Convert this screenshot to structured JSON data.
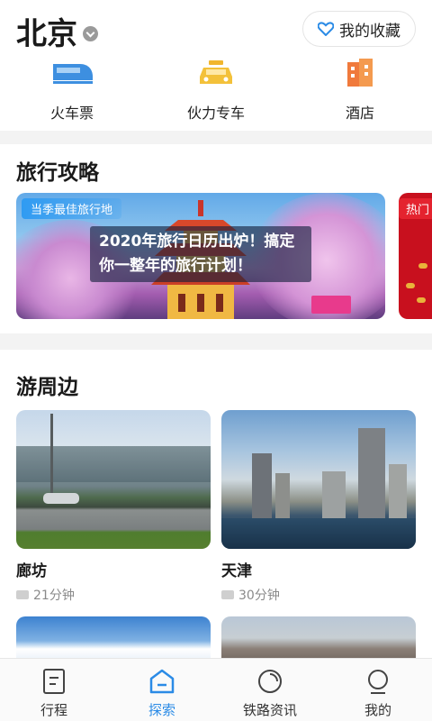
{
  "header": {
    "city": "北京",
    "favorites_label": "我的收藏"
  },
  "quick_links": [
    {
      "label": "火车票",
      "icon": "train-icon"
    },
    {
      "label": "伙力专车",
      "icon": "car-icon"
    },
    {
      "label": "酒店",
      "icon": "hotel-icon"
    }
  ],
  "guides": {
    "title": "旅行攻略",
    "banners": [
      {
        "tag": "当季最佳旅行地",
        "caption": "2020年旅行日历出炉！搞定你一整年的旅行计划！"
      },
      {
        "tag": "热门"
      }
    ]
  },
  "nearby": {
    "title": "游周边",
    "cards": [
      {
        "name": "廊坊",
        "duration": "21分钟"
      },
      {
        "name": "天津",
        "duration": "30分钟"
      }
    ]
  },
  "tabbar": {
    "tabs": [
      {
        "label": "行程",
        "icon": "itinerary-icon",
        "active": false
      },
      {
        "label": "探索",
        "icon": "explore-icon",
        "active": true
      },
      {
        "label": "铁路资讯",
        "icon": "railway-news-icon",
        "active": false
      },
      {
        "label": "我的",
        "icon": "profile-icon",
        "active": false
      }
    ]
  },
  "colors": {
    "accent": "#2b8be6",
    "section_bg": "#f3f3f3"
  }
}
